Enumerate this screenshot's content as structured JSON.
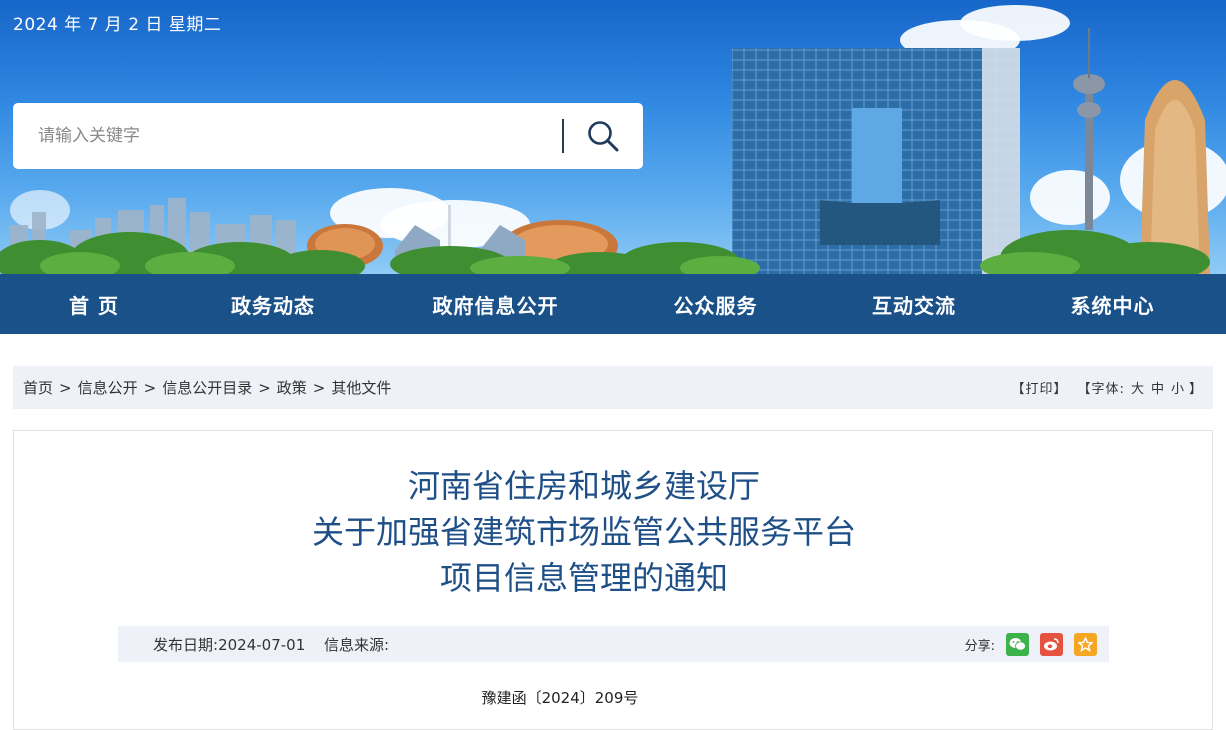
{
  "header": {
    "date": "2024 年 7 月 2 日   星期二",
    "search_placeholder": "请输入关键字"
  },
  "nav": {
    "items": [
      {
        "label": "首 页"
      },
      {
        "label": "政务动态"
      },
      {
        "label": "政府信息公开"
      },
      {
        "label": "公众服务"
      },
      {
        "label": "互动交流"
      },
      {
        "label": "系统中心"
      }
    ]
  },
  "breadcrumb": {
    "items": [
      "首页",
      "信息公开",
      "信息公开目录",
      "政策",
      "其他文件"
    ],
    "separator": ">"
  },
  "tools": {
    "print": "【打印】",
    "font_prefix": "【字体:",
    "font_large": "大",
    "font_medium": "中",
    "font_small": "小",
    "font_suffix": "】"
  },
  "article": {
    "title_line1": "河南省住房和城乡建设厅",
    "title_line2": "关于加强省建筑市场监管公共服务平台",
    "title_line3": "项目信息管理的通知",
    "publish_label": "发布日期:",
    "publish_date": "2024-07-01",
    "source_label": "信息来源:",
    "share_label": "分享:",
    "doc_number": "豫建函〔2024〕209号"
  },
  "colors": {
    "nav_bg": "#1a5189",
    "title": "#1f4f87",
    "crumb_bg": "#eef2f8",
    "wechat": "#3cb34a",
    "weibo": "#e5523f",
    "favorite": "#f5a623"
  },
  "icons": {
    "search": "magnifier",
    "share_wechat": "wechat-logo",
    "share_weibo": "weibo-logo",
    "share_favorite": "star"
  }
}
